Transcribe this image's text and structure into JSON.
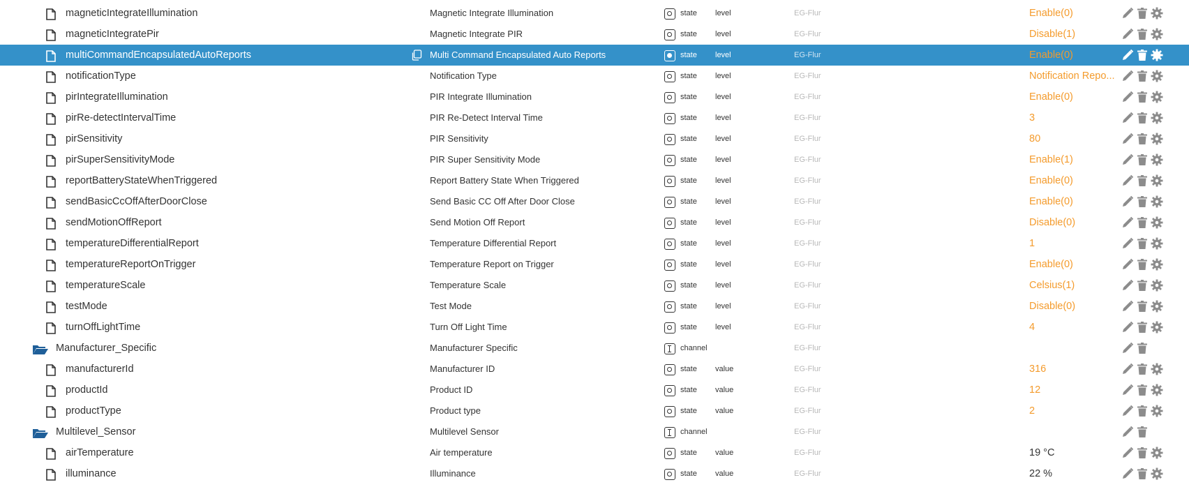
{
  "colors": {
    "selected_background": "#3491c9",
    "value_orange": "#f49b2c",
    "icon_gray": "#8c8c8c",
    "folder_blue": "#1f5f99",
    "room_gray": "#b8b8b8"
  },
  "rows": [
    {
      "kind": "state",
      "id": "magneticIntegrateIllumination",
      "name": "Magnetic Integrate Illumination",
      "type": "state",
      "role": "level",
      "room": "EG-Flur",
      "value": "Enable(0)"
    },
    {
      "kind": "state",
      "id": "magneticIntegratePir",
      "name": "Magnetic Integrate PIR",
      "type": "state",
      "role": "level",
      "room": "EG-Flur",
      "value": "Disable(1)"
    },
    {
      "kind": "state",
      "id": "multiCommandEncapsulatedAutoReports",
      "name": "Multi Command Encapsulated Auto Reports",
      "type": "state",
      "role": "level",
      "room": "EG-Flur",
      "value": "Enable(0)",
      "selected": true
    },
    {
      "kind": "state",
      "id": "notificationType",
      "name": "Notification Type",
      "type": "state",
      "role": "level",
      "room": "EG-Flur",
      "value": "Notification Repo..."
    },
    {
      "kind": "state",
      "id": "pirIntegrateIllumination",
      "name": "PIR Integrate Illumination",
      "type": "state",
      "role": "level",
      "room": "EG-Flur",
      "value": "Enable(0)"
    },
    {
      "kind": "state",
      "id": "pirRe-detectIntervalTime",
      "name": "PIR Re-Detect Interval Time",
      "type": "state",
      "role": "level",
      "room": "EG-Flur",
      "value": "3"
    },
    {
      "kind": "state",
      "id": "pirSensitivity",
      "name": "PIR Sensitivity",
      "type": "state",
      "role": "level",
      "room": "EG-Flur",
      "value": "80"
    },
    {
      "kind": "state",
      "id": "pirSuperSensitivityMode",
      "name": "PIR Super Sensitivity Mode",
      "type": "state",
      "role": "level",
      "room": "EG-Flur",
      "value": "Enable(1)"
    },
    {
      "kind": "state",
      "id": "reportBatteryStateWhenTriggered",
      "name": "Report Battery State When Triggered",
      "type": "state",
      "role": "level",
      "room": "EG-Flur",
      "value": "Enable(0)"
    },
    {
      "kind": "state",
      "id": "sendBasicCcOffAfterDoorClose",
      "name": "Send Basic CC Off After Door Close",
      "type": "state",
      "role": "level",
      "room": "EG-Flur",
      "value": "Enable(0)"
    },
    {
      "kind": "state",
      "id": "sendMotionOffReport",
      "name": "Send Motion Off Report",
      "type": "state",
      "role": "level",
      "room": "EG-Flur",
      "value": "Disable(0)"
    },
    {
      "kind": "state",
      "id": "temperatureDifferentialReport",
      "name": "Temperature Differential Report",
      "type": "state",
      "role": "level",
      "room": "EG-Flur",
      "value": "1"
    },
    {
      "kind": "state",
      "id": "temperatureReportOnTrigger",
      "name": "Temperature Report on Trigger",
      "type": "state",
      "role": "level",
      "room": "EG-Flur",
      "value": "Enable(0)"
    },
    {
      "kind": "state",
      "id": "temperatureScale",
      "name": "Temperature Scale",
      "type": "state",
      "role": "level",
      "room": "EG-Flur",
      "value": "Celsius(1)"
    },
    {
      "kind": "state",
      "id": "testMode",
      "name": "Test Mode",
      "type": "state",
      "role": "level",
      "room": "EG-Flur",
      "value": "Disable(0)"
    },
    {
      "kind": "state",
      "id": "turnOffLightTime",
      "name": "Turn Off Light Time",
      "type": "state",
      "role": "level",
      "room": "EG-Flur",
      "value": "4"
    },
    {
      "kind": "channel",
      "id": "Manufacturer_Specific",
      "name": "Manufacturer Specific",
      "type": "channel",
      "role": "",
      "room": "EG-Flur",
      "value": ""
    },
    {
      "kind": "state",
      "id": "manufacturerId",
      "name": "Manufacturer ID",
      "type": "state",
      "role": "value",
      "room": "EG-Flur",
      "value": "316"
    },
    {
      "kind": "state",
      "id": "productId",
      "name": "Product ID",
      "type": "state",
      "role": "value",
      "room": "EG-Flur",
      "value": "12"
    },
    {
      "kind": "state",
      "id": "productType",
      "name": "Product type",
      "type": "state",
      "role": "value",
      "room": "EG-Flur",
      "value": "2"
    },
    {
      "kind": "channel",
      "id": "Multilevel_Sensor",
      "name": "Multilevel Sensor",
      "type": "channel",
      "role": "",
      "room": "EG-Flur",
      "value": ""
    },
    {
      "kind": "state",
      "id": "airTemperature",
      "name": "Air temperature",
      "type": "state",
      "role": "value",
      "room": "EG-Flur",
      "value": "19 °C",
      "plain": true
    },
    {
      "kind": "state",
      "id": "illuminance",
      "name": "Illuminance",
      "type": "state",
      "role": "value",
      "room": "EG-Flur",
      "value": "22 %",
      "plain": true
    }
  ]
}
